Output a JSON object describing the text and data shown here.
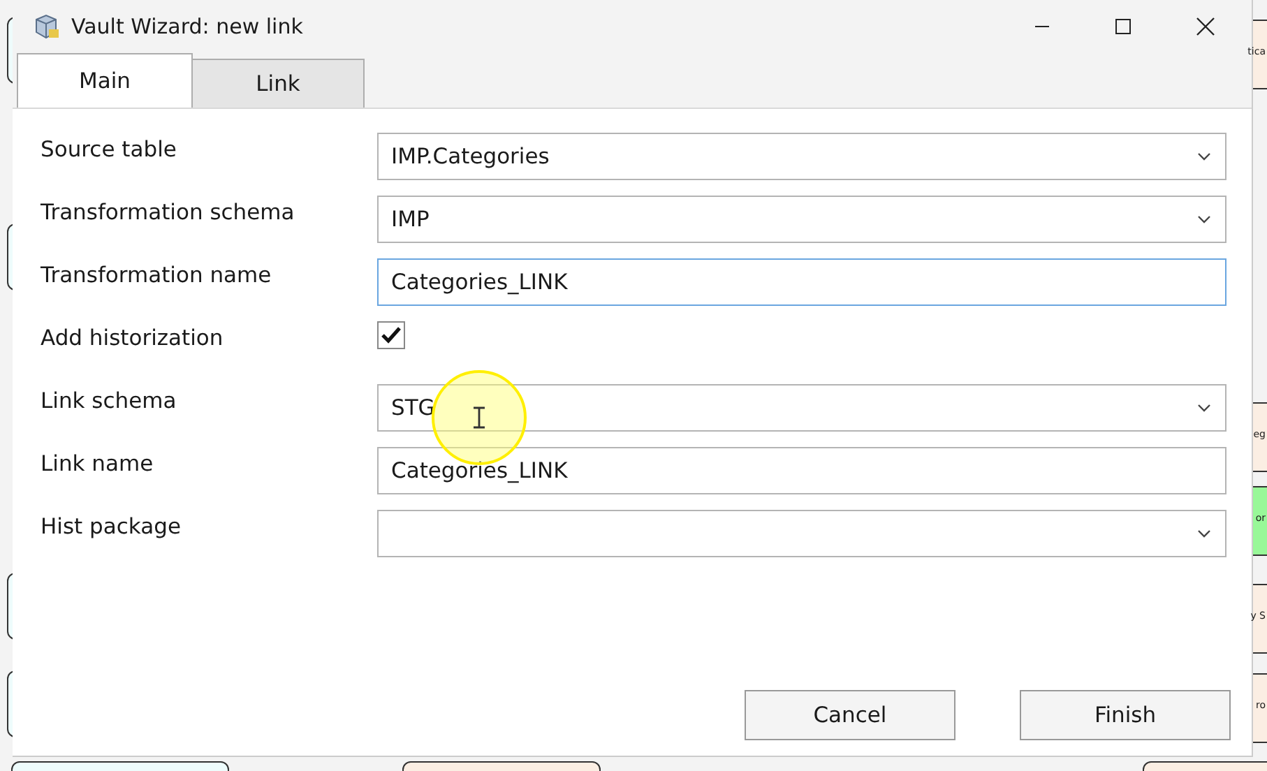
{
  "window": {
    "title": "Vault Wizard: new link"
  },
  "tabs": [
    {
      "label": "Main",
      "selected": true
    },
    {
      "label": "Link",
      "selected": false
    }
  ],
  "fields": [
    {
      "kind": "dropdown",
      "label": "Source table",
      "value": "IMP.Categories",
      "focused": false
    },
    {
      "kind": "dropdown",
      "label": "Transformation schema",
      "value": "IMP",
      "focused": false
    },
    {
      "kind": "text",
      "label": "Transformation name",
      "value": "Categories_LINK",
      "focused": true
    },
    {
      "kind": "checkbox",
      "label": "Add historization",
      "checked": true
    },
    {
      "kind": "dropdown",
      "label": "Link schema",
      "value": "STG",
      "focused": false
    },
    {
      "kind": "text",
      "label": "Link name",
      "value": "Categories_LINK",
      "focused": false
    },
    {
      "kind": "dropdown",
      "label": "Hist package",
      "focused": false
    }
  ],
  "buttons": [
    "Cancel",
    "Finish"
  ],
  "background_nodes": [
    {
      "text": "tica",
      "color": "#fbeee3"
    },
    {
      "text": "eg",
      "color": "#fbeee3"
    },
    {
      "text": "or",
      "color": "#98f898"
    },
    {
      "text": "y S",
      "color": "#fbeee3"
    },
    {
      "text": "ro",
      "color": "#fbeee3"
    }
  ]
}
